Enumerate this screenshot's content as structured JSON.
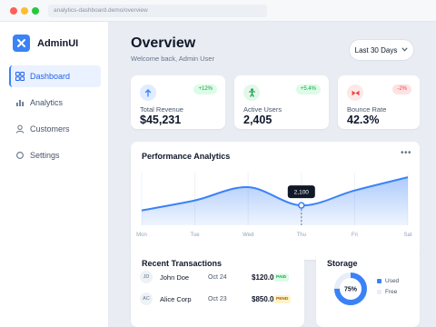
{
  "browser": {
    "url": "analytics-dashboard.demo/overview"
  },
  "sidebar": {
    "brand": "AdminUI",
    "items": [
      {
        "label": "Dashboard",
        "icon": "grid-icon",
        "active": true
      },
      {
        "label": "Analytics",
        "icon": "bar-chart-icon",
        "active": false
      },
      {
        "label": "Customers",
        "icon": "user-icon",
        "active": false
      },
      {
        "label": "Settings",
        "icon": "circle-icon",
        "active": false
      }
    ]
  },
  "header": {
    "title": "Overview",
    "subtitle": "Welcome back, Admin User",
    "range_label": "Last 30 Days"
  },
  "stats": [
    {
      "label": "Total Revenue",
      "value": "$45,231",
      "change": "+12%",
      "icon": "arrow-up-icon",
      "accent": "#3b82f6",
      "badge_bg": "#dcfce7",
      "badge_fg": "#16a34a",
      "icon_bg": "#e0ecff"
    },
    {
      "label": "Active Users",
      "value": "2,405",
      "change": "+5.4%",
      "icon": "user-figure-icon",
      "accent": "#16a34a",
      "badge_bg": "#dcfce7",
      "badge_fg": "#16a34a",
      "icon_bg": "#e3f7ea"
    },
    {
      "label": "Bounce Rate",
      "value": "42.3%",
      "change": "-2%",
      "icon": "bowtie-icon",
      "accent": "#ef4444",
      "badge_bg": "#fee2e2",
      "badge_fg": "#ef4444",
      "icon_bg": "#fde8e8"
    }
  ],
  "performance": {
    "title": "Performance Analytics",
    "more_label": "•••",
    "tooltip_value": "2,100",
    "tooltip_day": "Thu"
  },
  "chart_data": {
    "type": "area",
    "categories": [
      "Mon",
      "Tue",
      "Wed",
      "Thu",
      "Fri",
      "Sat"
    ],
    "values": [
      1950,
      2250,
      2650,
      2100,
      2550,
      2950
    ],
    "ylim": [
      1500,
      3200
    ],
    "grid": true,
    "highlight_index": 3
  },
  "transactions": {
    "title": "Recent Transactions",
    "rows": [
      {
        "initials": "JD",
        "name": "John Doe",
        "date": "Oct 24",
        "amount": "$120.0",
        "status": "PAID",
        "status_bg": "#dcfce7",
        "status_fg": "#16a34a"
      },
      {
        "initials": "AC",
        "name": "Alice Corp",
        "date": "Oct 23",
        "amount": "$850.0",
        "status": "PEND",
        "status_bg": "#fef3c7",
        "status_fg": "#b45309"
      }
    ]
  },
  "storage": {
    "title": "Storage",
    "percent_label": "75%",
    "used_fraction": 0.75,
    "legend": [
      {
        "label": "Used",
        "color": "#3b82f6"
      },
      {
        "label": "Free",
        "color": "#e8eef7"
      }
    ]
  },
  "colors": {
    "accent": "#3b82f6",
    "background": "#e9edf3"
  }
}
